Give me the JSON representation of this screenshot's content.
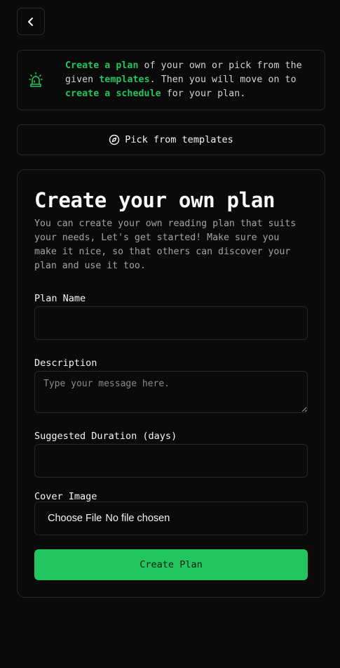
{
  "header": {
    "back_icon": "chevron-left-icon"
  },
  "notice": {
    "icon": "siren-alarm-icon",
    "t1": "Create a plan",
    "t2": " of your own or pick from the given ",
    "t3": "templates",
    "t4": ". Then you will move on to ",
    "t5": "create a schedule",
    "t6": " for your plan."
  },
  "templates_button": {
    "icon": "compass-icon",
    "label": "Pick from templates"
  },
  "form": {
    "title": "Create your own plan",
    "intro": "You can create your own reading plan that suits your needs, Let's get started! Make sure you make it nice, so that others can discover your plan and use it too.",
    "plan_name": {
      "label": "Plan Name",
      "value": ""
    },
    "description": {
      "label": "Description",
      "placeholder": "Type your message here.",
      "value": ""
    },
    "duration": {
      "label": "Suggested Duration (days)",
      "value": ""
    },
    "cover": {
      "label": "Cover Image",
      "choose_label": "Choose File",
      "status": "No file chosen"
    },
    "submit_label": "Create Plan"
  },
  "colors": {
    "accent": "#22c55e",
    "background": "#0a0a0a",
    "border": "#262626"
  }
}
